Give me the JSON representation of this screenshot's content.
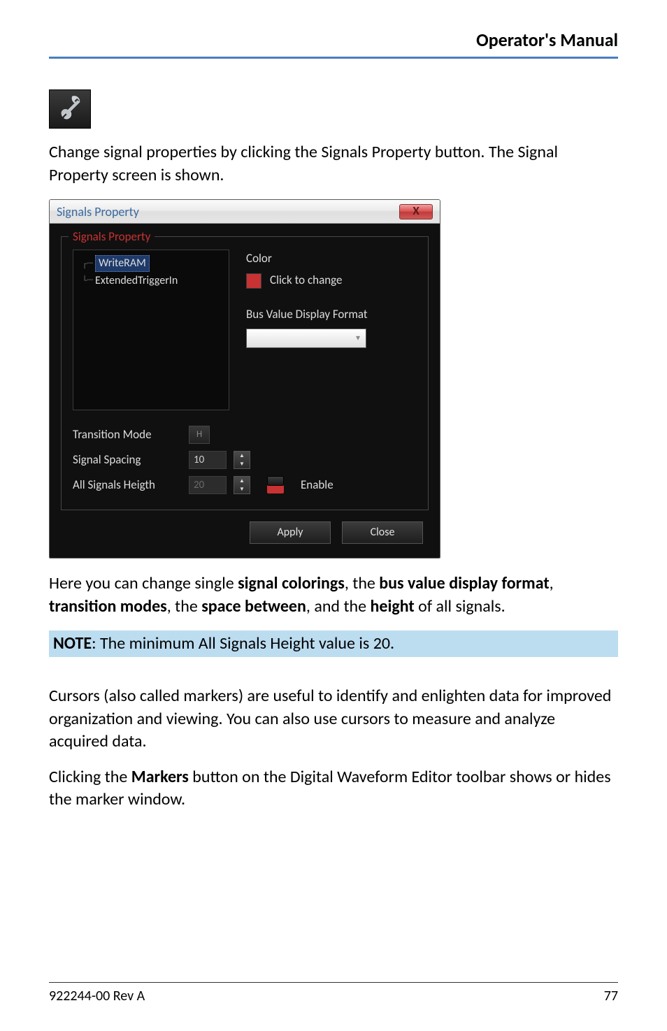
{
  "header": {
    "title": "Operator's Manual"
  },
  "paragraphs": {
    "intro": "Change signal properties by clicking the Signals Property button. The Signal Property screen is shown.",
    "caption_pre": "Here you can change single ",
    "caption_b1": "signal colorings",
    "caption_mid1": ", the ",
    "caption_b2": "bus value display format",
    "caption_mid2": ", ",
    "caption_b3": "transition modes",
    "caption_mid3": ", the ",
    "caption_b4": "space between",
    "caption_mid4": ", and the ",
    "caption_b5": "height",
    "caption_end": " of all signals.",
    "note_b": "NOTE",
    "note_rest": ": The minimum All Signals Height value is 20.",
    "cursors": "Cursors (also called markers) are useful to identify and enlighten data for improved organization and viewing. You can also use cursors to measure and analyze acquired data.",
    "markers_pre": "Clicking the ",
    "markers_b": "Markers",
    "markers_post": " button on the Digital Waveform Editor toolbar shows or hides the marker window."
  },
  "dialog": {
    "title": "Signals Property",
    "close_glyph": "X",
    "group_legend": "Signals Property",
    "tree": {
      "item1": "WriteRAM",
      "item2": "ExtendedTriggerIn"
    },
    "color_lbl": "Color",
    "color_hint": "Click to change",
    "bvdf_lbl": "Bus Value Display Format",
    "transition_lbl": "Transition Mode",
    "spacing_lbl": "Signal Spacing",
    "spacing_val": "10",
    "height_lbl": "All Signals Heigth",
    "height_val": "20",
    "enable_lbl": "Enable",
    "apply_btn": "Apply",
    "close_btn": "Close",
    "tm_glyph": "H"
  },
  "footer": {
    "left": "922244-00 Rev A",
    "right": "77"
  },
  "colors": {
    "accent_red": "#c83232",
    "header_blue": "#4a7ec0"
  }
}
